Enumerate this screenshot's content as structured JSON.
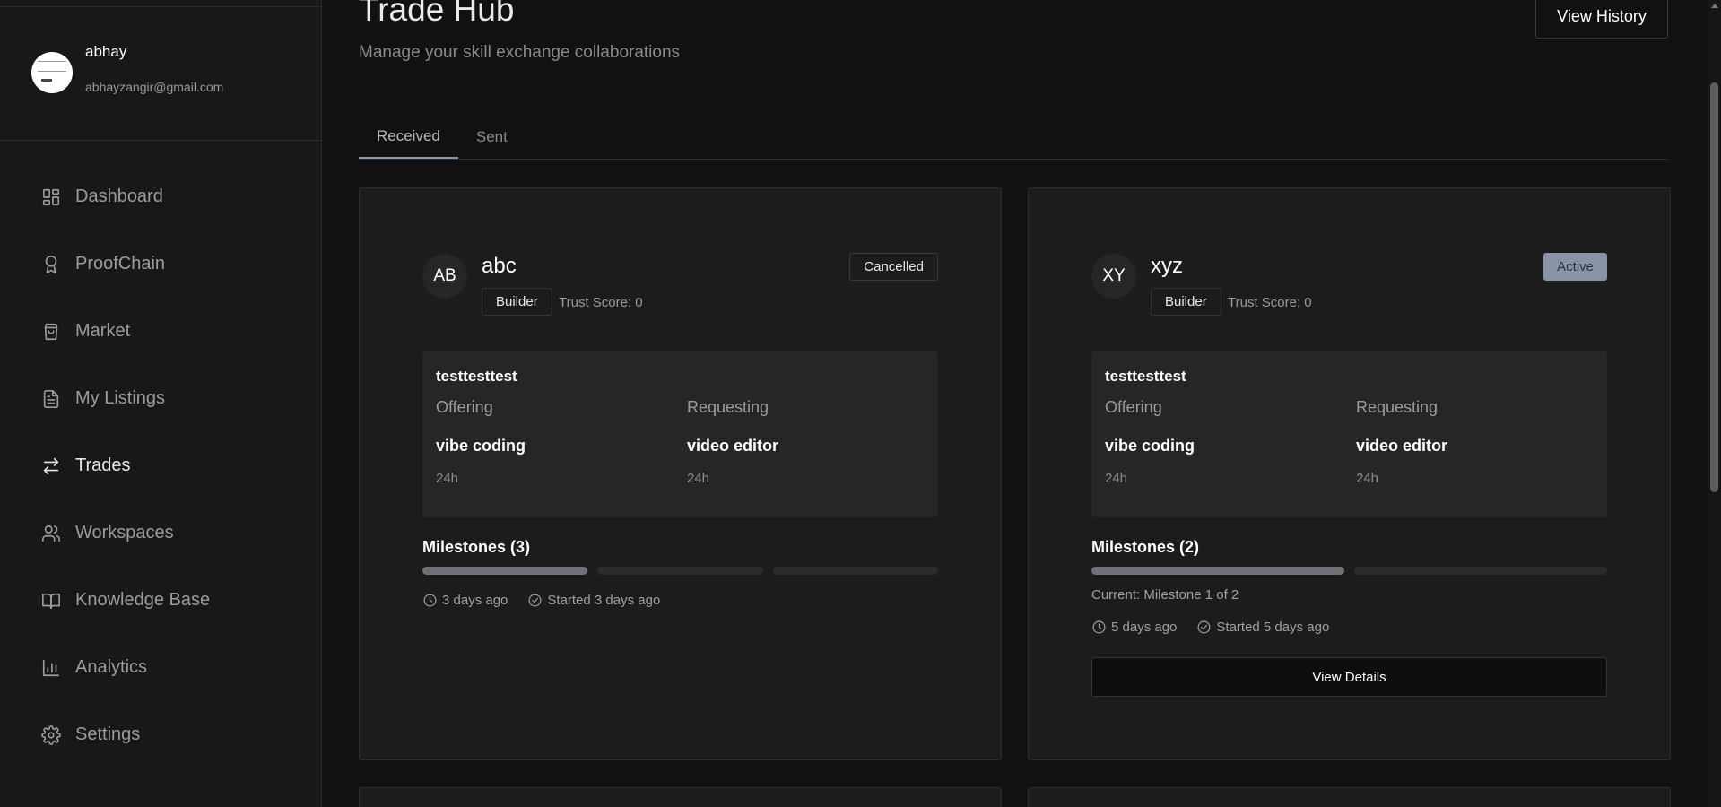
{
  "user": {
    "name": "abhay",
    "email": "abhayzangir@gmail.com"
  },
  "sidebar": {
    "items": [
      {
        "label": "Dashboard",
        "icon": "grid-icon"
      },
      {
        "label": "ProofChain",
        "icon": "award-icon"
      },
      {
        "label": "Market",
        "icon": "shopping-bag-icon"
      },
      {
        "label": "My Listings",
        "icon": "document-icon"
      },
      {
        "label": "Trades",
        "icon": "swap-icon",
        "active": true
      },
      {
        "label": "Workspaces",
        "icon": "users-icon"
      },
      {
        "label": "Knowledge Base",
        "icon": "book-icon"
      },
      {
        "label": "Analytics",
        "icon": "bar-chart-icon"
      },
      {
        "label": "Settings",
        "icon": "gear-icon"
      }
    ]
  },
  "header": {
    "title": "Trade Hub",
    "subtitle": "Manage your skill exchange collaborations",
    "history_button": "View History"
  },
  "tabs": [
    {
      "label": "Received",
      "active": true
    },
    {
      "label": "Sent",
      "active": false
    }
  ],
  "trades": [
    {
      "initials": "AB",
      "name": "abc",
      "role": "Builder",
      "trust": "Trust Score: 0",
      "status": "Cancelled",
      "title": "testtesttest",
      "offering_label": "Offering",
      "requesting_label": "Requesting",
      "offering": "vibe coding",
      "requesting": "video editor",
      "offering_duration": "24h",
      "requesting_duration": "24h",
      "milestones_label": "Milestones (3)",
      "milestones_total": 3,
      "milestones_done": 1,
      "time_ago": "3 days ago",
      "started": "Started 3 days ago"
    },
    {
      "initials": "XY",
      "name": "xyz",
      "role": "Builder",
      "trust": "Trust Score: 0",
      "status": "Active",
      "title": "testtesttest",
      "offering_label": "Offering",
      "requesting_label": "Requesting",
      "offering": "vibe coding",
      "requesting": "video editor",
      "offering_duration": "24h",
      "requesting_duration": "24h",
      "milestones_label": "Milestones (2)",
      "milestones_total": 2,
      "milestones_done": 1,
      "current_milestone": "Current: Milestone 1 of 2",
      "time_ago": "5 days ago",
      "started": "Started 5 days ago",
      "details_button": "View Details"
    }
  ]
}
